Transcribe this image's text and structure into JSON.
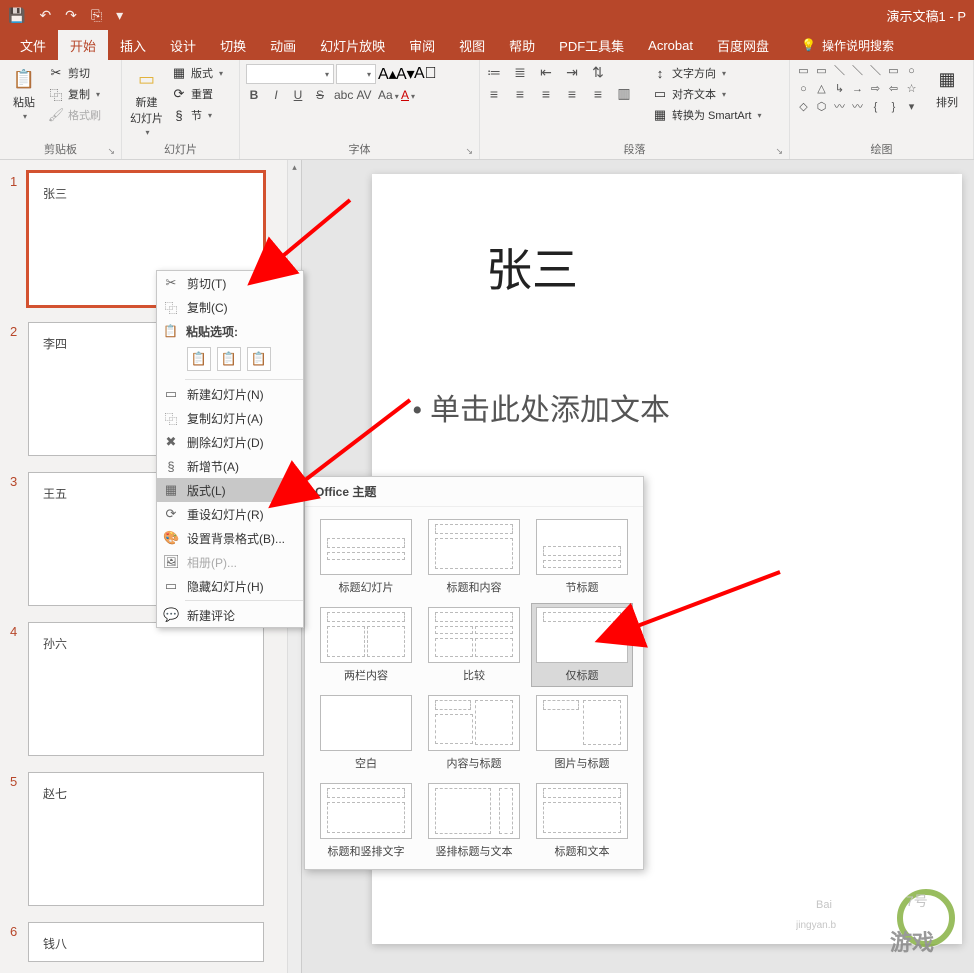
{
  "window": {
    "title": "演示文稿1 - P",
    "qat": [
      "💾",
      "↶",
      "↷",
      "⎘",
      "▾"
    ]
  },
  "tabs": {
    "items": [
      "文件",
      "开始",
      "插入",
      "设计",
      "切换",
      "动画",
      "幻灯片放映",
      "审阅",
      "视图",
      "帮助",
      "PDF工具集",
      "Acrobat",
      "百度网盘"
    ],
    "active": "开始",
    "search": "操作说明搜索"
  },
  "ribbon": {
    "clipboard": {
      "label": "剪贴板",
      "paste": "粘贴",
      "cut": "剪切",
      "copy": "复制",
      "fmtpainter": "格式刷"
    },
    "slides": {
      "label": "幻灯片",
      "newslide": "新建\n幻灯片",
      "layout": "版式",
      "reset": "重置",
      "section": "节"
    },
    "font": {
      "label": "字体"
    },
    "paragraph": {
      "label": "段落",
      "textdir": "文字方向",
      "align": "对齐文本",
      "smartart": "转换为 SmartArt"
    },
    "drawing": {
      "label": "绘图",
      "arrange": "排列"
    }
  },
  "thumbs": {
    "items": [
      {
        "num": "1",
        "text": "张三"
      },
      {
        "num": "2",
        "text": "李四"
      },
      {
        "num": "3",
        "text": "王五"
      },
      {
        "num": "4",
        "text": "孙六"
      },
      {
        "num": "5",
        "text": "赵七"
      },
      {
        "num": "6",
        "text": "钱八"
      }
    ]
  },
  "slide": {
    "title": "张三",
    "body": "• 单击此处添加文本"
  },
  "context": {
    "cut": "剪切(T)",
    "copy": "复制(C)",
    "paste_header": "粘贴选项:",
    "newslide": "新建幻灯片(N)",
    "dupslide": "复制幻灯片(A)",
    "delslide": "删除幻灯片(D)",
    "newsection": "新增节(A)",
    "layout": "版式(L)",
    "resetslide": "重设幻灯片(R)",
    "formatbg": "设置背景格式(B)...",
    "album": "相册(P)...",
    "hideslide": "隐藏幻灯片(H)",
    "newcomment": "新建评论"
  },
  "flyout": {
    "header": "Office 主题",
    "layouts": [
      "标题幻灯片",
      "标题和内容",
      "节标题",
      "两栏内容",
      "比较",
      "仅标题",
      "空白",
      "内容与标题",
      "图片与标题",
      "标题和竖排文字",
      "竖排标题与文本",
      "标题和文本"
    ],
    "selected": "仅标题"
  }
}
